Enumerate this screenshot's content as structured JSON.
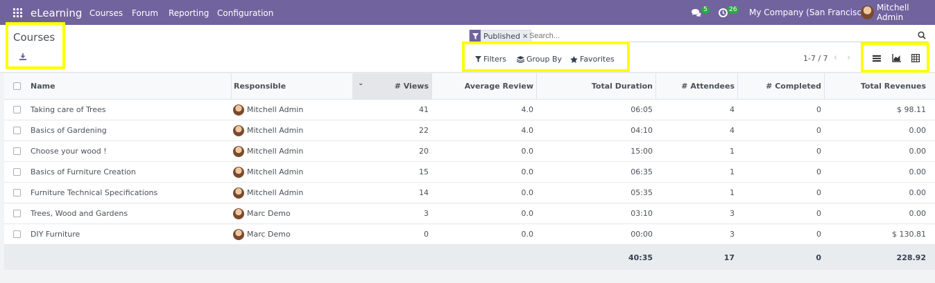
{
  "topbar": {
    "app": "eLearning",
    "menu": [
      "Courses",
      "Forum",
      "Reporting",
      "Configuration"
    ],
    "messages_count": "5",
    "activities_count": "26",
    "company": "My Company (San Francisco)",
    "user": "Mitchell Admin"
  },
  "control": {
    "title": "Courses",
    "facet": "Published",
    "search_placeholder": "Search...",
    "filters": "Filters",
    "group_by": "Group By",
    "favorites": "Favorites",
    "pager": "1-7 / 7"
  },
  "table": {
    "headers": [
      "Name",
      "Responsible",
      "# Views",
      "Average Review",
      "Total Duration",
      "# Attendees",
      "# Completed",
      "Total Revenues"
    ],
    "rows": [
      {
        "name": "Taking care of Trees",
        "responsible": "Mitchell Admin",
        "views": "41",
        "review": "4.0",
        "duration": "06:05",
        "attendees": "4",
        "completed": "0",
        "revenue": "$ 98.11"
      },
      {
        "name": "Basics of Gardening",
        "responsible": "Mitchell Admin",
        "views": "22",
        "review": "4.0",
        "duration": "04:10",
        "attendees": "4",
        "completed": "0",
        "revenue": "0.00"
      },
      {
        "name": "Choose your wood !",
        "responsible": "Mitchell Admin",
        "views": "20",
        "review": "0.0",
        "duration": "15:00",
        "attendees": "1",
        "completed": "0",
        "revenue": "0.00"
      },
      {
        "name": "Basics of Furniture Creation",
        "responsible": "Mitchell Admin",
        "views": "15",
        "review": "0.0",
        "duration": "06:35",
        "attendees": "1",
        "completed": "0",
        "revenue": "0.00"
      },
      {
        "name": "Furniture Technical Specifications",
        "responsible": "Mitchell Admin",
        "views": "14",
        "review": "0.0",
        "duration": "05:35",
        "attendees": "1",
        "completed": "0",
        "revenue": "0.00"
      },
      {
        "name": "Trees, Wood and Gardens",
        "responsible": "Marc Demo",
        "views": "3",
        "review": "0.0",
        "duration": "03:10",
        "attendees": "3",
        "completed": "0",
        "revenue": "0.00"
      },
      {
        "name": "DIY Furniture",
        "responsible": "Marc Demo",
        "views": "0",
        "review": "0.0",
        "duration": "00:00",
        "attendees": "3",
        "completed": "0",
        "revenue": "$ 130.81"
      }
    ],
    "totals": {
      "duration": "40:35",
      "attendees": "17",
      "completed": "0",
      "revenue": "228.92"
    }
  }
}
